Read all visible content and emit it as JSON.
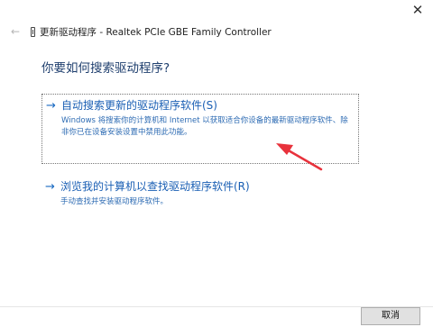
{
  "window": {
    "close_glyph": "✕",
    "back_glyph": "←",
    "title": "更新驱动程序 - Realtek PCIe GBE Family Controller"
  },
  "main": {
    "heading": "你要如何搜索驱动程序?",
    "options": [
      {
        "arrow": "→",
        "title": "自动搜索更新的驱动程序软件(S)",
        "description": "Windows 将搜索你的计算机和 Internet 以获取适合你设备的最新驱动程序软件、除非你已在设备安装设置中禁用此功能。"
      },
      {
        "arrow": "→",
        "title": "浏览我的计算机以查找驱动程序软件(R)",
        "description": "手动查找并安装驱动程序软件。"
      }
    ]
  },
  "footer": {
    "cancel_label": "取消"
  },
  "icons": {
    "close": "close-icon",
    "back": "back-arrow-icon",
    "device": "network-adapter-icon",
    "option_arrow": "arrow-right-icon"
  },
  "colors": {
    "link_blue": "#1a5fb4",
    "heading_blue": "#1f3f6e",
    "annotation_red": "#e8323c"
  }
}
